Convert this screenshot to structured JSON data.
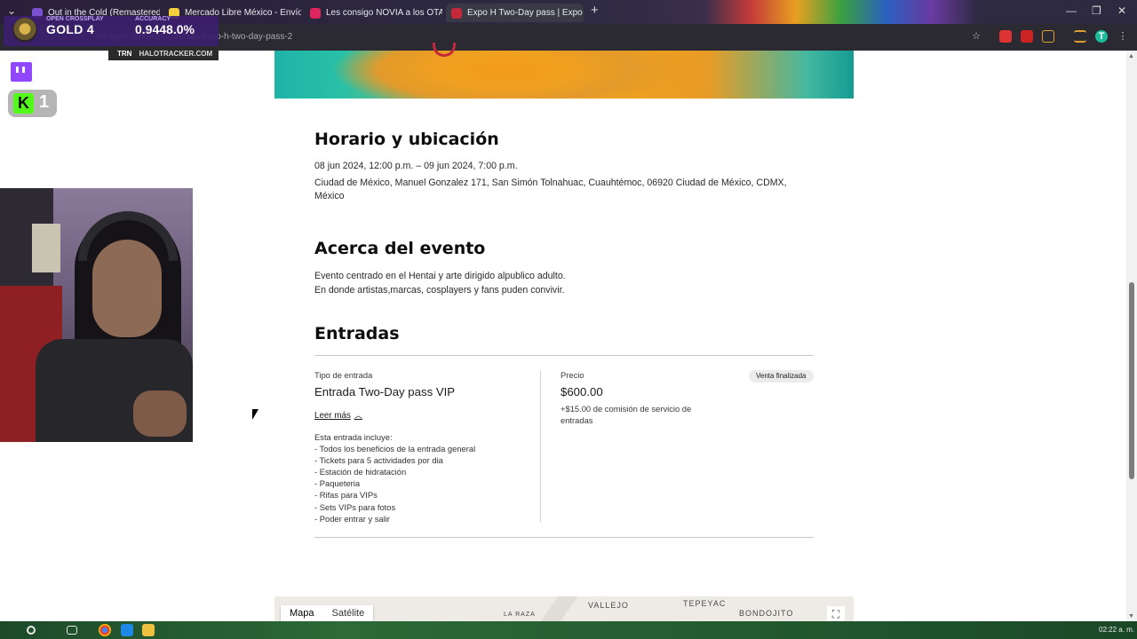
{
  "browser": {
    "tabs": [
      {
        "title": "Out in the Cold (Remastered) -",
        "favicon_color": "#7a4fd0"
      },
      {
        "title": "Mercado Libre México - Envíos",
        "favicon_color": "#f4d03f"
      },
      {
        "title": "Les consigo NOVIA a los OTAK",
        "favicon_color": "#e0245e"
      },
      {
        "title": "Expo H Two-Day pass | Expo H",
        "favicon_color": "#c4283b"
      }
    ],
    "new_tab_label": "+",
    "close_label": "✕",
    "url": "laexpoh.com/event-details/expo-h-two-day-pass-2",
    "window_controls": {
      "minimize": "—",
      "maximize": "❐",
      "close": "✕"
    }
  },
  "stream_overlay": {
    "rank_tier": "GOLD 4",
    "rank_percent": "0.9448.0%",
    "top_left_caption": "OPEN CROSSPLAY",
    "top_mid_caption": "ACCURACY",
    "tracker_brand": "TRN",
    "tracker_site": "HALOTRACKER.COM",
    "kick_letter": "K",
    "kick_count": "1"
  },
  "event": {
    "schedule_heading": "Horario y ubicación",
    "dates": "08 jun 2024, 12:00 p.m. – 09 jun 2024, 7:00 p.m.",
    "address": "Ciudad de México, Manuel Gonzalez 171, San Simón Tolnahuac, Cuauhtémoc, 06920 Ciudad de México, CDMX, México",
    "about_heading": "Acerca del evento",
    "about_line1": "Evento centrado en el Hentai y arte dirigido alpublico adulto.",
    "about_line2": "En donde artistas,marcas, cosplayers y fans puden convivir.",
    "tickets_heading": "Entradas",
    "ticket": {
      "type_label": "Tipo de entrada",
      "type_name": "Entrada Two-Day pass VIP",
      "read_more": "Leer más",
      "includes": [
        "Esta entrada incluye:",
        "- Todos los beneficios de la entrada general",
        "- Tickets para 5 actividades por dia",
        "- Estación de hidratación",
        "- Paqueteria",
        "- Rifas para VIPs",
        "- Sets VIPs para fotos",
        "- Poder entrar y salir"
      ],
      "price_label": "Precio",
      "price": "$600.00",
      "fee": "+$15.00 de comisión de servicio de entradas",
      "status": "Venta finalizada"
    }
  },
  "map": {
    "tab_map": "Mapa",
    "tab_satellite": "Satélite",
    "labels": [
      "LA RAZA",
      "VALLEJO",
      "TEPEYAC",
      "BONDOJITO"
    ],
    "fullscreen_icon": "⛶"
  },
  "taskbar": {
    "clock": "02:22 a. m."
  },
  "colors": {
    "twitch": "#9146ff",
    "kick": "#53fc18",
    "rank_panel": "#3c1e6e",
    "badge_bg": "#ececec"
  }
}
